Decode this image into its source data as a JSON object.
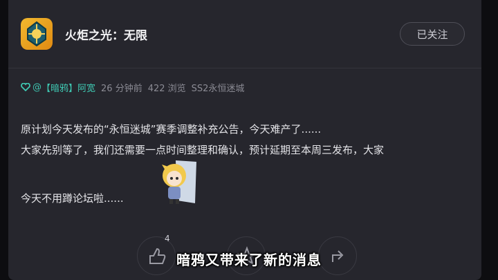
{
  "header": {
    "app_name": "火炬之光：无限",
    "follow_label": "已关注",
    "app_icon": "game-logo-icon"
  },
  "post": {
    "meta": {
      "heart_icon": "heart-icon",
      "at": "@",
      "author_tag": "【暗鸦】阿宽",
      "time": "26 分钟前",
      "views": "422 浏览",
      "section": "SS2永恒迷城"
    },
    "lines": [
      "原计划今天发布的“永恒迷城”赛季调整补充公告，今天难产了......",
      "大家先别等了，我们还需要一点时间整理和确认，预计延期至本周三发布，大家",
      "今天不用蹲论坛啦......"
    ]
  },
  "actions": {
    "like_count": "4",
    "like_icon": "thumbs-up-icon",
    "collect_icon": "star-icon",
    "share_icon": "share-icon"
  },
  "subtitle": "暗鸦又带来了新的消息",
  "colors": {
    "accent": "#3fc8b2",
    "card_bg": "#26262d",
    "page_bg": "#0d0d10"
  }
}
